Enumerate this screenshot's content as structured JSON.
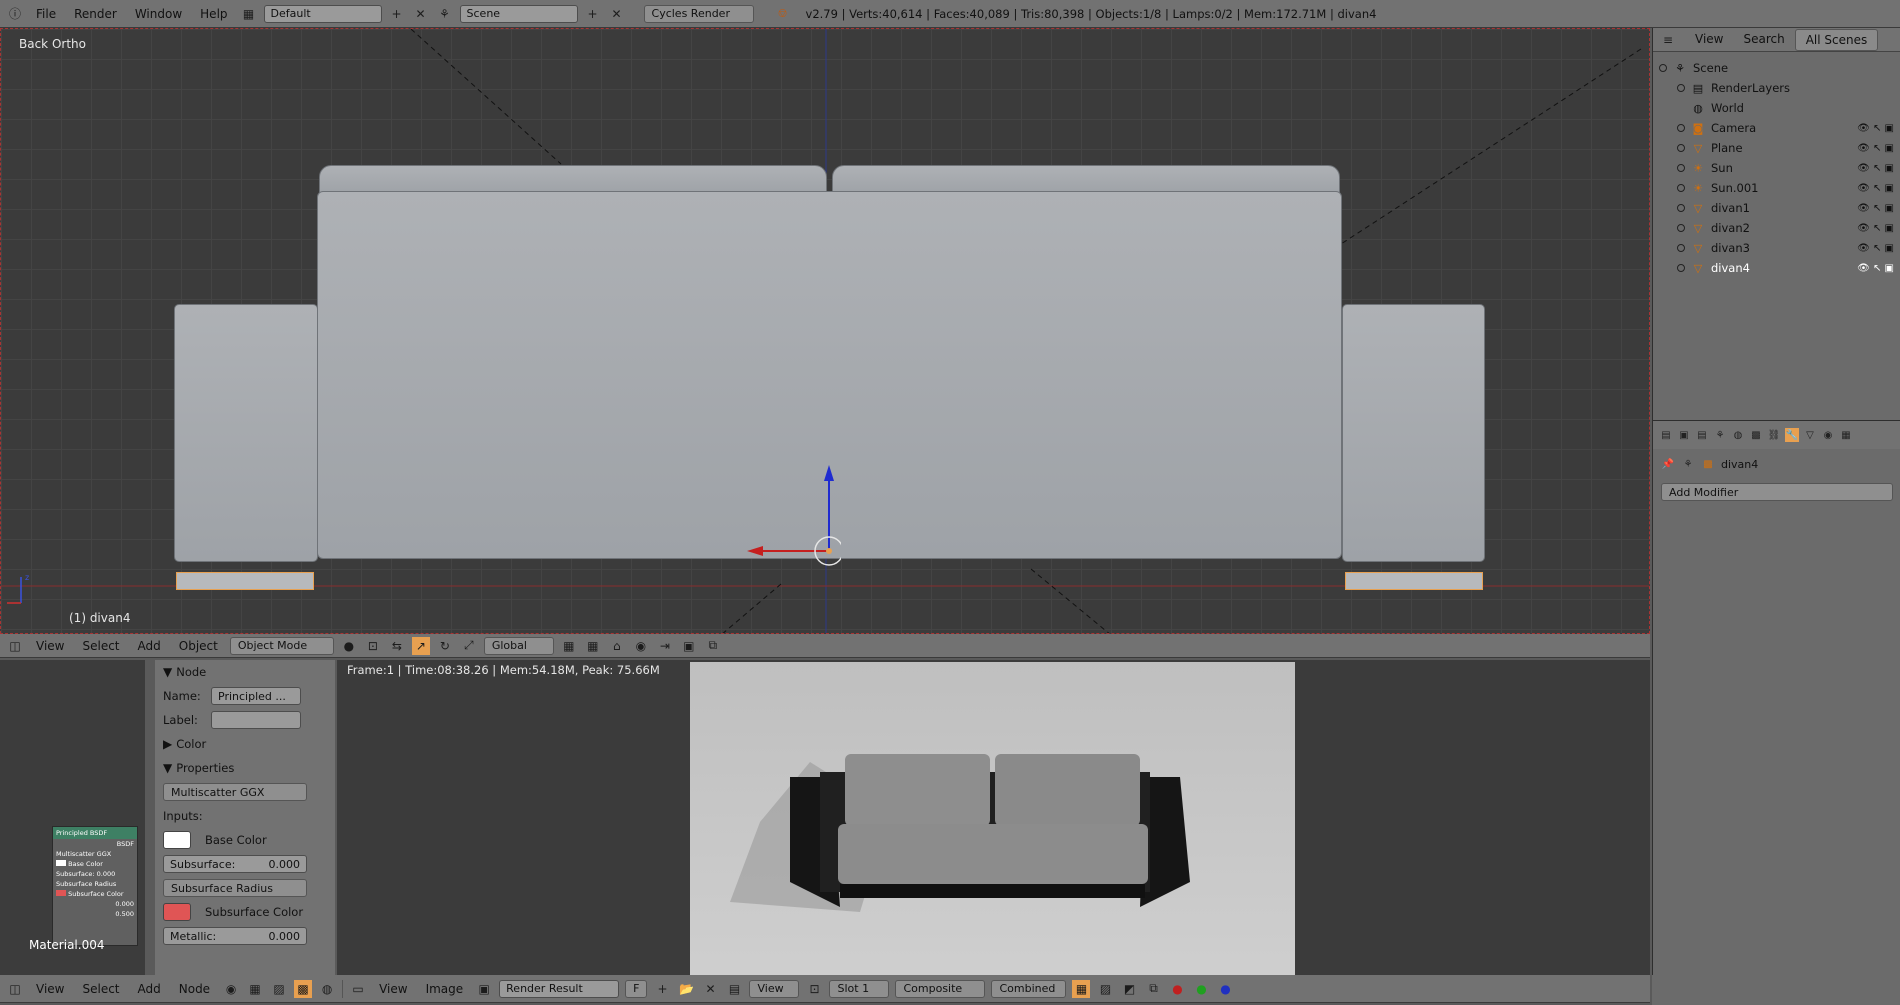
{
  "top_header": {
    "menus": [
      "File",
      "Render",
      "Window",
      "Help"
    ],
    "layout": "Default",
    "scene": "Scene",
    "engine": "Cycles Render",
    "stats": "v2.79 | Verts:40,614 | Faces:40,089 | Tris:80,398 | Objects:1/8 | Lamps:0/2 | Mem:172.71M | divan4"
  },
  "viewport": {
    "view_label": "Back Ortho",
    "object_label": "(1) divan4"
  },
  "viewport_header": {
    "menus": [
      "View",
      "Select",
      "Add",
      "Object"
    ],
    "mode": "Object Mode",
    "orientation": "Global"
  },
  "outliner": {
    "tabs": [
      "View",
      "Search",
      "All Scenes"
    ],
    "items": [
      {
        "label": "Scene",
        "icon": "scene-icon"
      },
      {
        "label": "RenderLayers",
        "icon": "render-layers-icon"
      },
      {
        "label": "World",
        "icon": "world-icon"
      },
      {
        "label": "Camera",
        "icon": "camera-icon"
      },
      {
        "label": "Plane",
        "icon": "mesh-icon"
      },
      {
        "label": "Sun",
        "icon": "lamp-icon"
      },
      {
        "label": "Sun.001",
        "icon": "lamp-icon"
      },
      {
        "label": "divan1",
        "icon": "mesh-icon"
      },
      {
        "label": "divan2",
        "icon": "mesh-icon"
      },
      {
        "label": "divan3",
        "icon": "mesh-icon"
      },
      {
        "label": "divan4",
        "icon": "mesh-icon"
      }
    ]
  },
  "properties": {
    "object_name": "divan4",
    "add_modifier": "Add Modifier"
  },
  "node_panel": {
    "node_title": "Node",
    "name_label": "Name:",
    "name_value": "Principled ...",
    "label_label": "Label:",
    "color_section": "Color",
    "properties_section": "Properties",
    "distribution": "Multiscatter GGX",
    "inputs_label": "Inputs:",
    "base_color_label": "Base Color",
    "subsurface_label": "Subsurface:",
    "subsurface_value": "0.000",
    "subsurface_radius": "Subsurface Radius",
    "subsurface_color_label": "Subsurface Color",
    "metallic_label": "Metallic:",
    "metallic_value": "0.000"
  },
  "node_editor": {
    "node_title": "Principled BSDF",
    "node_out": "BSDF",
    "node_dist": "Multiscatter GGX",
    "node_base": "Base Color",
    "node_sub": "Subsurface: 0.000",
    "node_radius": "Subsurface Radius",
    "node_subcolor": "Subsurface Color",
    "node_metal": "0.000",
    "node_spec": "0.500",
    "material": "Material.004"
  },
  "image_editor": {
    "info": "Frame:1 | Time:08:38.26 | Mem:54.18M, Peak: 75.66M"
  },
  "bottom_header": {
    "node_menus": [
      "View",
      "Select",
      "Add",
      "Node"
    ],
    "image_menus": [
      "View",
      "Image"
    ],
    "image_name": "Render Result",
    "f_label": "F",
    "view_label": "View",
    "slot": "Slot 1",
    "layer": "Composite",
    "pass": "Combined"
  },
  "colors": {
    "viewport_bg": "#3b3b3b",
    "header_bg": "#727272",
    "accent_orange": "#e8a050",
    "base_color_swatch": "#ffffff",
    "subsurface_swatch": "#e05555"
  }
}
